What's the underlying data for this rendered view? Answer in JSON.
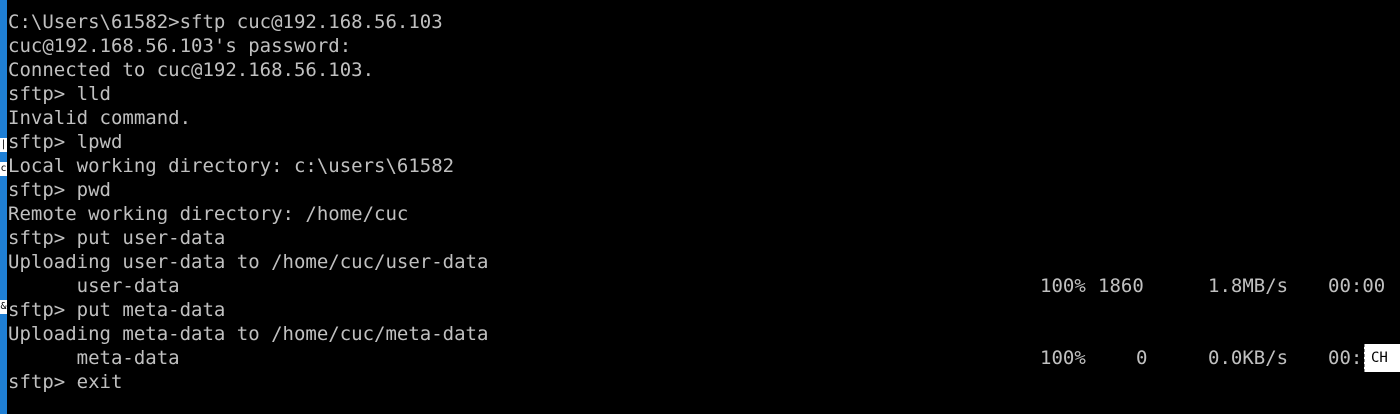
{
  "terminal": {
    "lines": [
      "C:\\Users\\61582>sftp cuc@192.168.56.103",
      "cuc@192.168.56.103's password:",
      "Connected to cuc@192.168.56.103.",
      "sftp> lld",
      "Invalid command.",
      "sftp> lpwd",
      "Local working directory: c:\\users\\61582",
      "sftp> pwd",
      "Remote working directory: /home/cuc",
      "sftp> put user-data",
      "Uploading user-data to /home/cuc/user-data",
      "user-data",
      "sftp> put meta-data",
      "Uploading meta-data to /home/cuc/meta-data",
      "meta-data",
      "sftp> exit"
    ],
    "transfers": [
      {
        "percent": "100%",
        "size": "1860",
        "rate": "1.8MB/s",
        "time": "00:00"
      },
      {
        "percent": "100%",
        "size": "0",
        "rate": "0.0KB/s",
        "time": "00:"
      }
    ]
  },
  "ime_indicator": {
    "label": "CH"
  },
  "edge_glyphs": [
    "|",
    "c",
    "&"
  ],
  "colors": {
    "background": "#000000",
    "text": "#c0c0c0",
    "left_edge": "#1f7fd4"
  }
}
